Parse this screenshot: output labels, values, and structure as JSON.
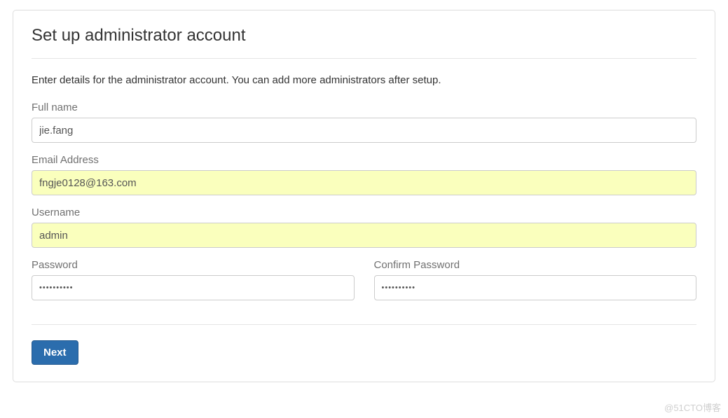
{
  "panel": {
    "title": "Set up administrator account",
    "description": "Enter details for the administrator account. You can add more administrators after setup."
  },
  "form": {
    "fullname": {
      "label": "Full name",
      "value": "jie.fang"
    },
    "email": {
      "label": "Email Address",
      "value": "fngje0128@163.com"
    },
    "username": {
      "label": "Username",
      "value": "admin"
    },
    "password": {
      "label": "Password",
      "value": "••••••••••"
    },
    "confirm_password": {
      "label": "Confirm Password",
      "value": "••••••••••"
    }
  },
  "actions": {
    "next_label": "Next"
  },
  "watermark": "@51CTO博客"
}
